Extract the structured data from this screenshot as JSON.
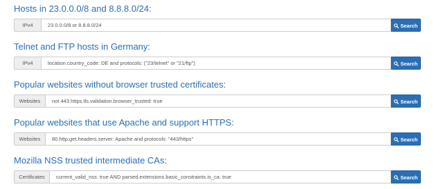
{
  "search_label": "Search",
  "examples": [
    {
      "title": "Hosts in 23.0.0.0/8 and 8.8.8.0/24:",
      "addon": "IPv4",
      "query": "23.0.0.0/8 or 8.8.8.0/24"
    },
    {
      "title": "Telnet and FTP hosts in Germany:",
      "addon": "IPv4",
      "query": "location.country_code: DE and protocols: (\"23/telnet\" or \"21/ftp\")"
    },
    {
      "title": "Popular websites without browser trusted certificates:",
      "addon": "Websites",
      "query": "not 443.https.tls.validation.browser_trusted: true"
    },
    {
      "title": "Popular websites that use Apache and support HTTPS:",
      "addon": "Websites",
      "query": "80.http.get.headers.server: Apache and protocols: \"443/https\""
    },
    {
      "title": "Mozilla NSS trusted intermediate CAs:",
      "addon": "Certificates",
      "query": "current_valid_nss: true AND parsed.extensions.basic_constraints.is_ca: true"
    }
  ],
  "colors": {
    "accent": "#2a6fb5",
    "addon_bg": "#eeeeee",
    "border": "#cccccc"
  },
  "icons": {
    "search": "magnifier-icon"
  }
}
